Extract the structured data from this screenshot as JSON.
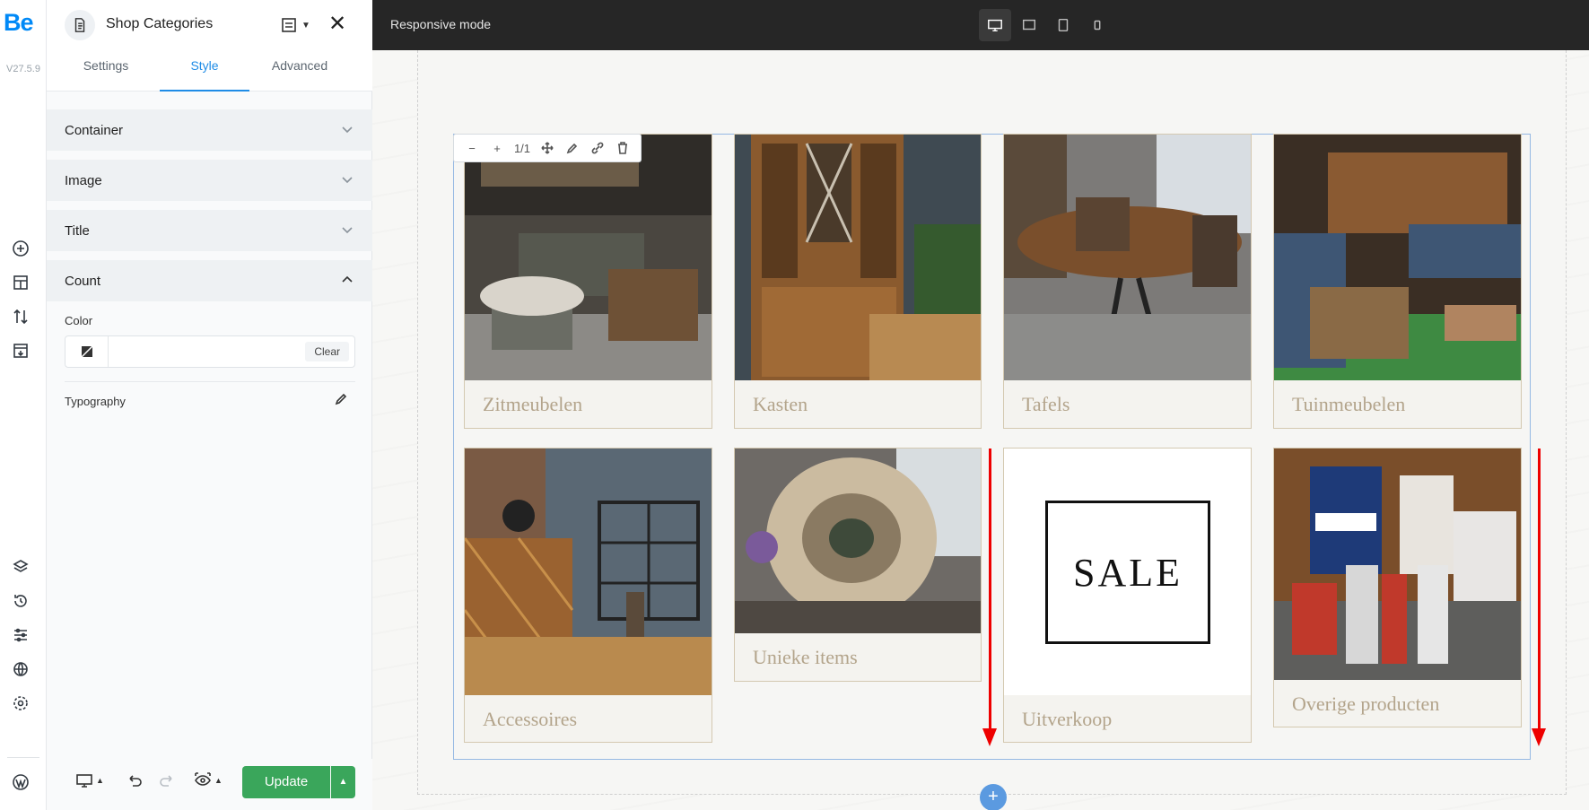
{
  "app": {
    "logo": "Be",
    "version": "V27.5.9"
  },
  "panel": {
    "title": "Shop Categories",
    "tabs": [
      {
        "label": "Settings"
      },
      {
        "label": "Style"
      },
      {
        "label": "Advanced"
      }
    ],
    "active_tab": "Style",
    "sections": [
      {
        "label": "Container",
        "state": "collapsed"
      },
      {
        "label": "Image",
        "state": "collapsed"
      },
      {
        "label": "Title",
        "state": "collapsed"
      },
      {
        "label": "Count",
        "state": "expanded"
      }
    ],
    "color_label": "Color",
    "color_value": "",
    "clear_label": "Clear",
    "typography_label": "Typography",
    "update_label": "Update"
  },
  "topbar": {
    "mode_label": "Responsive mode",
    "devices": [
      "desktop-icon",
      "laptop-icon",
      "tablet-icon",
      "mobile-icon"
    ],
    "active_device": "desktop-icon"
  },
  "canvas": {
    "toolbar_ratio": "1/1",
    "categories": [
      {
        "name": "Zitmeubelen"
      },
      {
        "name": "Kasten"
      },
      {
        "name": "Tafels"
      },
      {
        "name": "Tuinmeubelen"
      },
      {
        "name": "Accessoires"
      },
      {
        "name": "Unieke items"
      },
      {
        "name": "Uitverkoop"
      },
      {
        "name": "Overige producten"
      }
    ],
    "sale_text": "SALE"
  },
  "colors": {
    "accent": "#1f8ce6",
    "update_button": "#3aa65b",
    "topbar": "#262626",
    "caption": "#b3a48b",
    "annotation_arrow": "#e00000",
    "selection_border": "#95b8e3"
  }
}
